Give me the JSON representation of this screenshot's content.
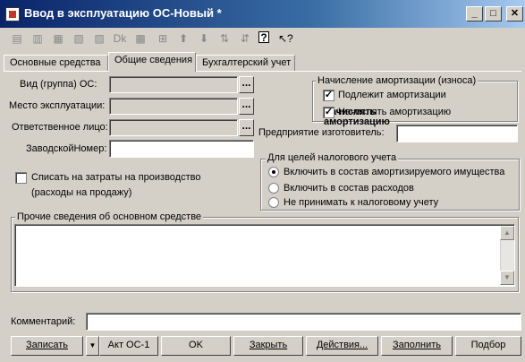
{
  "window": {
    "title": "Ввод в эксплуатацию ОС-Новый *",
    "btn_min": "_",
    "btn_max": "□",
    "btn_close": "✕"
  },
  "toolbar": {
    "icons": [
      "new-icon",
      "copy-icon",
      "delete-icon",
      "edit-icon",
      "mark-icon",
      "post-icon",
      "unpost-icon",
      "hierarchy-icon",
      "up-arrow-icon",
      "down-arrow-icon",
      "sort-asc-icon",
      "sort-desc-icon",
      "help-icon",
      "whats-this-icon"
    ]
  },
  "tabs": [
    {
      "label": "Основные средства"
    },
    {
      "label": "Общие сведения"
    },
    {
      "label": "Бухгалтерский учет"
    }
  ],
  "form": {
    "group_label": "Вид (группа) ОС:",
    "place_label": "Место эксплуатации:",
    "person_label": "Ответственное лицо:",
    "serial_label": "ЗаводскойНомер:",
    "dots": "...",
    "write_off_label_line1": "Списать на затраты на производство",
    "write_off_label_line2": "(расходы на продажу)",
    "manufacturer_label": "Предприятие изготовитель:"
  },
  "amort": {
    "title": "Начисление амортизации (износа)",
    "subject_label": "Подлежит амортизации",
    "accrue_label": "Начислять амортизацию",
    "check": "✓"
  },
  "tax": {
    "title": "Для целей налогового учета",
    "opt1": "Включить в состав амортизируемого имущества",
    "opt2": "Включить в состав расходов",
    "opt3": "Не принимать к налоговому учету"
  },
  "other": {
    "title": "Прочие сведения об основном средстве"
  },
  "comment": {
    "label": "Комментарий:"
  },
  "buttons": {
    "write": "Записать",
    "dropdown": "▼",
    "act": "Акт ОС-1",
    "ok": "OK",
    "close": "Закрыть",
    "actions": "Действия...",
    "fill": "Заполнить",
    "select": "Подбор"
  }
}
